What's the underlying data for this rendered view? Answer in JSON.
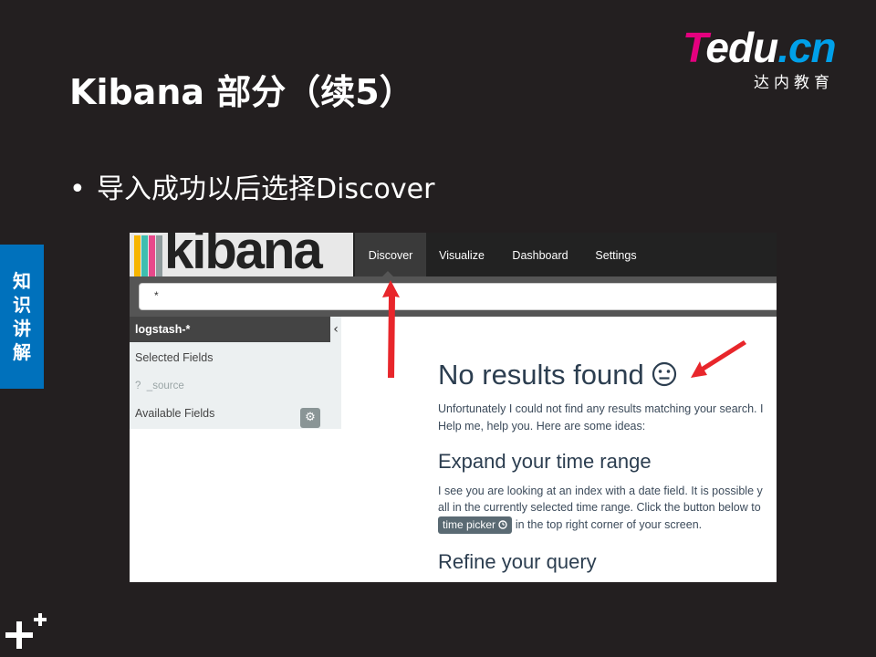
{
  "slide": {
    "title": "Kibana 部分（续5）",
    "bullet_marker": "•",
    "bullet": "导入成功以后选择Discover",
    "side_tab": [
      "知",
      "识",
      "讲",
      "解"
    ]
  },
  "logo": {
    "word_t": "T",
    "word_edu": "edu",
    "word_cn": ".cn",
    "sub": "达内教育"
  },
  "kibana": {
    "brand": "kibana",
    "nav_tabs": [
      {
        "label": "Discover",
        "active": true
      },
      {
        "label": "Visualize",
        "active": false
      },
      {
        "label": "Dashboard",
        "active": false
      },
      {
        "label": "Settings",
        "active": false
      }
    ],
    "search": {
      "value": "*"
    },
    "sidebar": {
      "index_pattern": "logstash-*",
      "collapse_glyph": "‹",
      "selected_fields_label": "Selected Fields",
      "source_field_type": "?",
      "source_field_name": "_source",
      "available_fields_label": "Available Fields",
      "gear_icon": "gear-icon"
    },
    "main": {
      "heading": "No results found",
      "heading_emoji": "😐",
      "intro_line1": "Unfortunately I could not find any results matching your search. I",
      "intro_line2": "Help me, help you. Here are some ideas:",
      "expand_heading": "Expand your time range",
      "expand_line1": "I see you are looking at an index with a date field. It is possible y",
      "expand_line2": "all in the currently selected time range. Click the button below to",
      "time_picker_button": "time picker",
      "time_picker_icon": "clock-icon",
      "expand_line3": "in the top right corner of your screen.",
      "refine_heading": "Refine your query"
    }
  },
  "colors": {
    "slide_bg": "#231f20",
    "side_tab": "#0071bc",
    "arrow": "#e8262b",
    "logo_pink": "#e4007f",
    "logo_blue": "#00a0e9",
    "kibana_bars": [
      "#f7b500",
      "#3ebeb0",
      "#e8488b",
      "#8e9b9d"
    ]
  }
}
